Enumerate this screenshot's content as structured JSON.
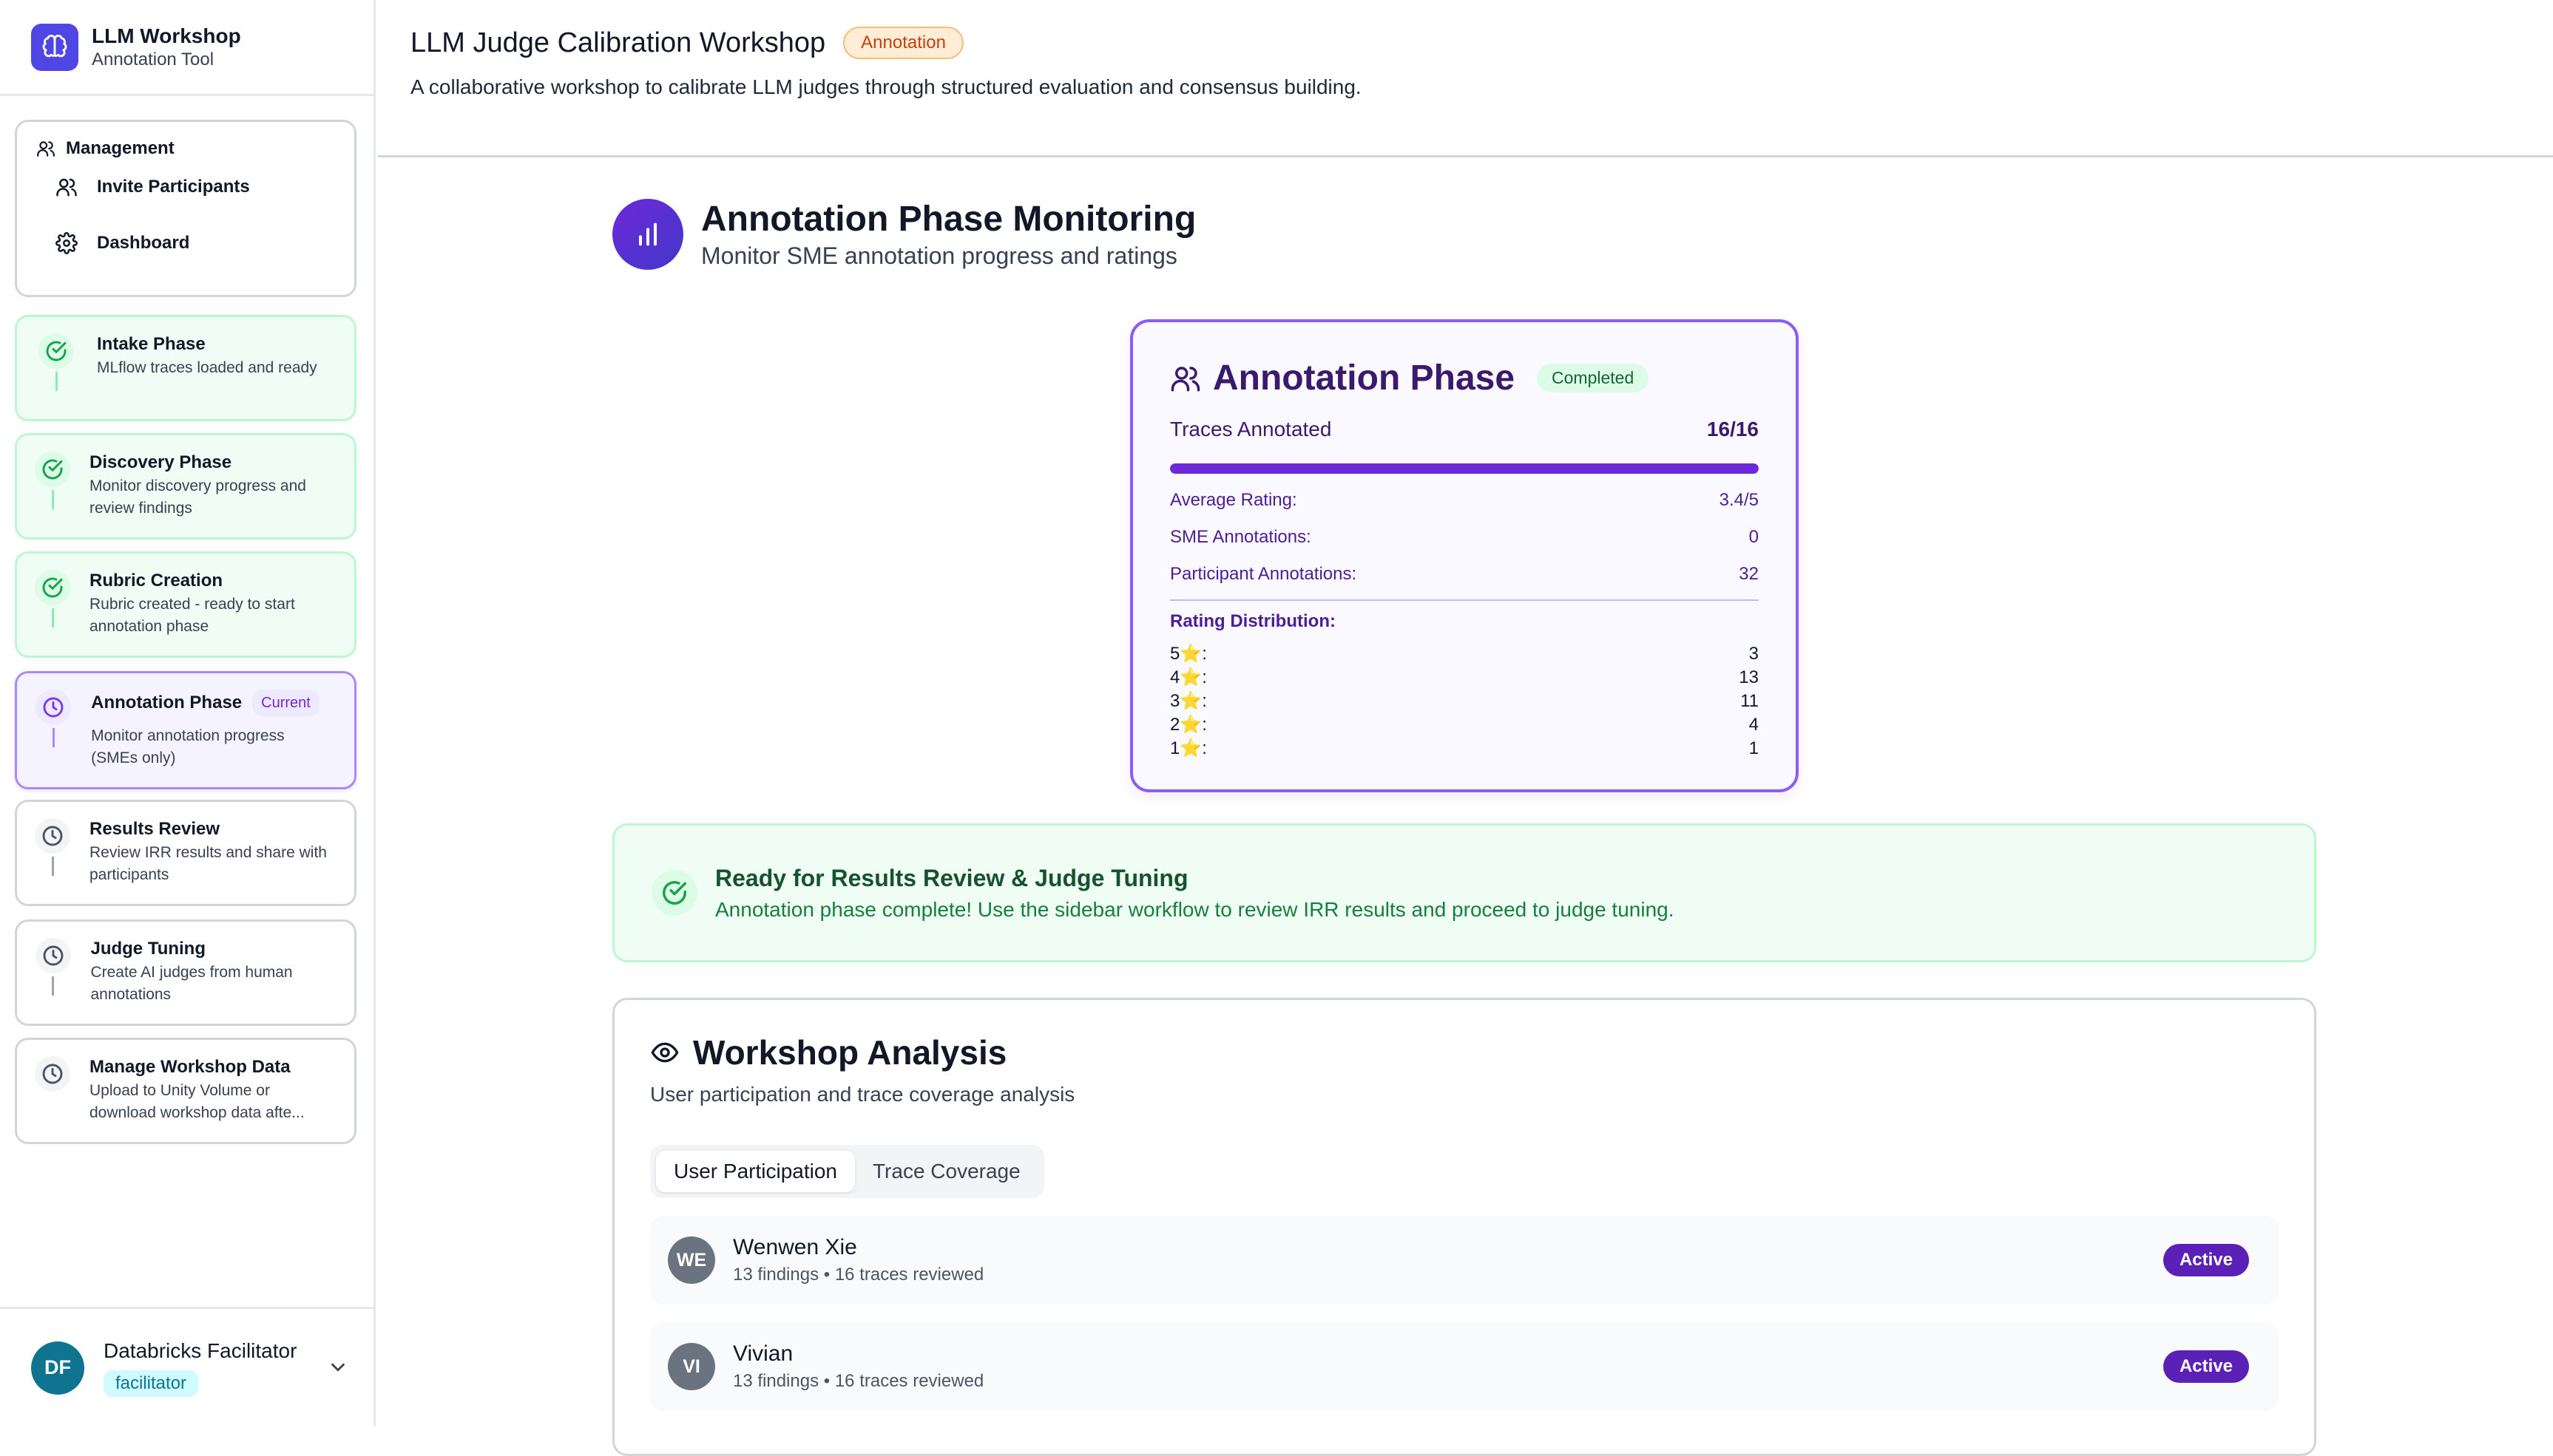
{
  "brand": {
    "title": "LLM Workshop",
    "subtitle": "Annotation Tool",
    "icon": "brain-icon"
  },
  "management": {
    "heading": "Management",
    "items": [
      {
        "label": "Invite Participants",
        "icon": "users-icon"
      },
      {
        "label": "Dashboard",
        "icon": "gear-icon"
      }
    ]
  },
  "phases": [
    {
      "title": "Intake Phase",
      "desc": "MLflow traces loaded and ready",
      "state": "done"
    },
    {
      "title": "Discovery Phase",
      "desc": "Monitor discovery progress and review findings",
      "state": "done"
    },
    {
      "title": "Rubric Creation",
      "desc": "Rubric created - ready to start annotation phase",
      "state": "done"
    },
    {
      "title": "Annotation Phase",
      "desc": "Monitor annotation progress (SMEs only)",
      "state": "current",
      "badge": "Current"
    },
    {
      "title": "Results Review",
      "desc": "Review IRR results and share with participants",
      "state": "todo"
    },
    {
      "title": "Judge Tuning",
      "desc": "Create AI judges from human annotations",
      "state": "todo"
    },
    {
      "title": "Manage Workshop Data",
      "desc": "Upload to Unity Volume or download workshop data afte...",
      "state": "todo"
    }
  ],
  "user": {
    "initials": "DF",
    "name": "Databricks Facilitator",
    "role": "facilitator"
  },
  "header": {
    "title": "LLM Judge Calibration Workshop",
    "badge": "Annotation",
    "description": "A collaborative workshop to calibrate LLM judges through structured evaluation and consensus building."
  },
  "page": {
    "title": "Annotation Phase Monitoring",
    "subtitle": "Monitor SME annotation progress and ratings"
  },
  "annotation_card": {
    "title": "Annotation Phase",
    "status": "Completed",
    "traces_label": "Traces Annotated",
    "traces_value": "16/16",
    "progress_fraction": 1.0,
    "avg_label": "Average Rating:",
    "avg_value": "3.4/5",
    "sme_label": "SME Annotations:",
    "sme_value": "0",
    "participant_label": "Participant Annotations:",
    "participant_value": "32",
    "dist_heading": "Rating Distribution:",
    "distribution": [
      {
        "label": "5⭐:",
        "count": "3"
      },
      {
        "label": "4⭐:",
        "count": "13"
      },
      {
        "label": "3⭐:",
        "count": "11"
      },
      {
        "label": "2⭐:",
        "count": "4"
      },
      {
        "label": "1⭐:",
        "count": "1"
      }
    ]
  },
  "ready": {
    "title": "Ready for Results Review & Judge Tuning",
    "desc": "Annotation phase complete! Use the sidebar workflow to review IRR results and proceed to judge tuning."
  },
  "analysis": {
    "title": "Workshop Analysis",
    "subtitle": "User participation and trace coverage analysis",
    "tabs": [
      "User Participation",
      "Trace Coverage"
    ],
    "participants": [
      {
        "initials": "WE",
        "name": "Wenwen Xie",
        "meta": "13 findings • 16 traces reviewed",
        "status": "Active"
      },
      {
        "initials": "VI",
        "name": "Vivian",
        "meta": "13 findings • 16 traces reviewed",
        "status": "Active"
      }
    ]
  }
}
